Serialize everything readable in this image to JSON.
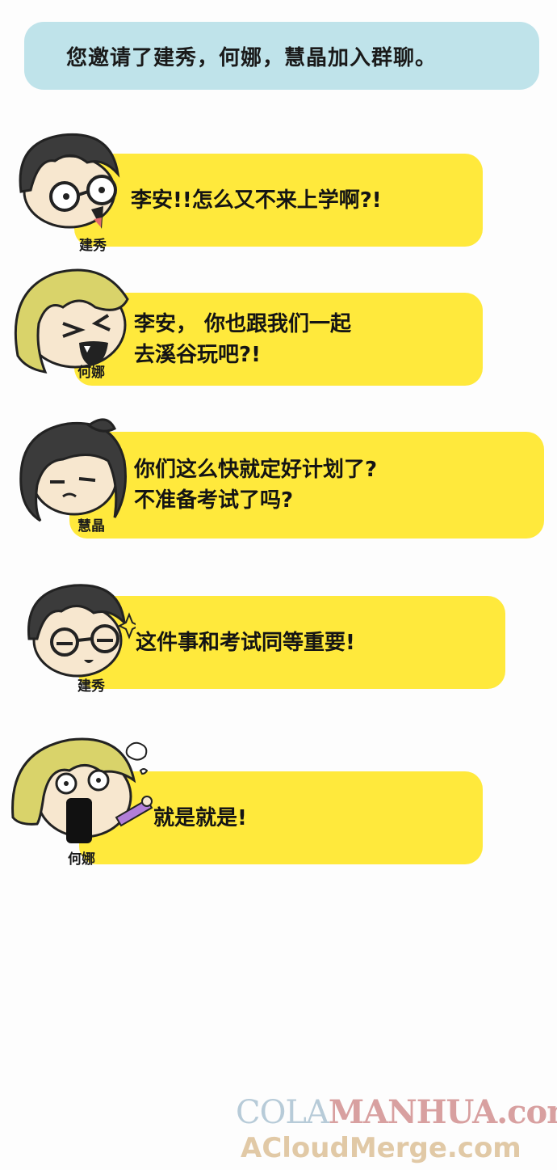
{
  "system": {
    "text": "您邀请了建秀，何娜，慧晶加入群聊。"
  },
  "messages": [
    {
      "sender": "建秀",
      "lines": [
        "李安!!怎么又不来上学啊?!"
      ]
    },
    {
      "sender": "何娜",
      "lines": [
        "李安， 你也跟我们一起",
        "去溪谷玩吧?!"
      ]
    },
    {
      "sender": "慧晶",
      "lines": [
        "你们这么快就定好计划了?",
        "不准备考试了吗?"
      ]
    },
    {
      "sender": "建秀",
      "lines": [
        "这件事和考试同等重要!"
      ]
    },
    {
      "sender": "何娜",
      "lines": [
        "就是就是!"
      ]
    }
  ],
  "watermark": {
    "line1_a": "COLA",
    "line1_b": "MANHUA.com",
    "line2": "ACloudMerge.com"
  },
  "colors": {
    "system_bubble": "#bfe3ea",
    "chat_bubble": "#ffe93c",
    "hair_dark": "#3b3b3b",
    "hair_blonde": "#d9d36a",
    "skin": "#f7e7cf"
  }
}
